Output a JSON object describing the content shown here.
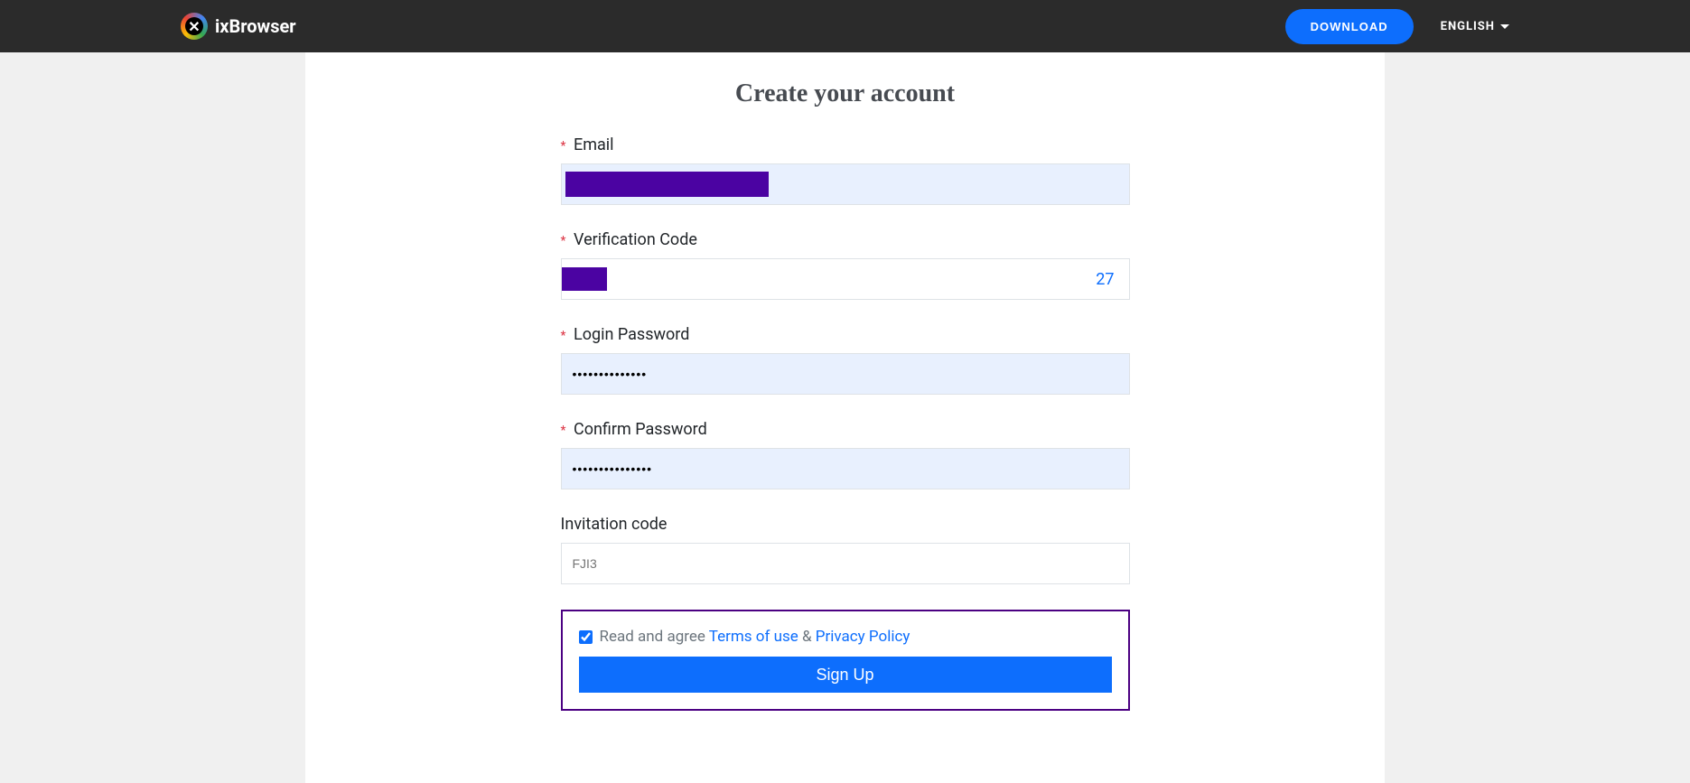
{
  "header": {
    "brand_name": "ixBrowser",
    "download_label": "DOWNLOAD",
    "language_label": "ENGLISH"
  },
  "page": {
    "title": "Create your account"
  },
  "form": {
    "email": {
      "label": "Email",
      "required": true,
      "value": ""
    },
    "verification": {
      "label": "Verification Code",
      "required": true,
      "countdown": "27"
    },
    "login_password": {
      "label": "Login Password",
      "required": true,
      "value": "••••••••••••••"
    },
    "confirm_password": {
      "label": "Confirm Password",
      "required": true,
      "value": "•••••••••••••••"
    },
    "invitation": {
      "label": "Invitation code",
      "required": false,
      "placeholder": "FJI3"
    },
    "agreement": {
      "checked": true,
      "prefix_text": "Read and agree ",
      "terms_label": "Terms of use",
      "separator": " & ",
      "privacy_label": "Privacy Policy"
    },
    "submit_label": "Sign Up"
  }
}
